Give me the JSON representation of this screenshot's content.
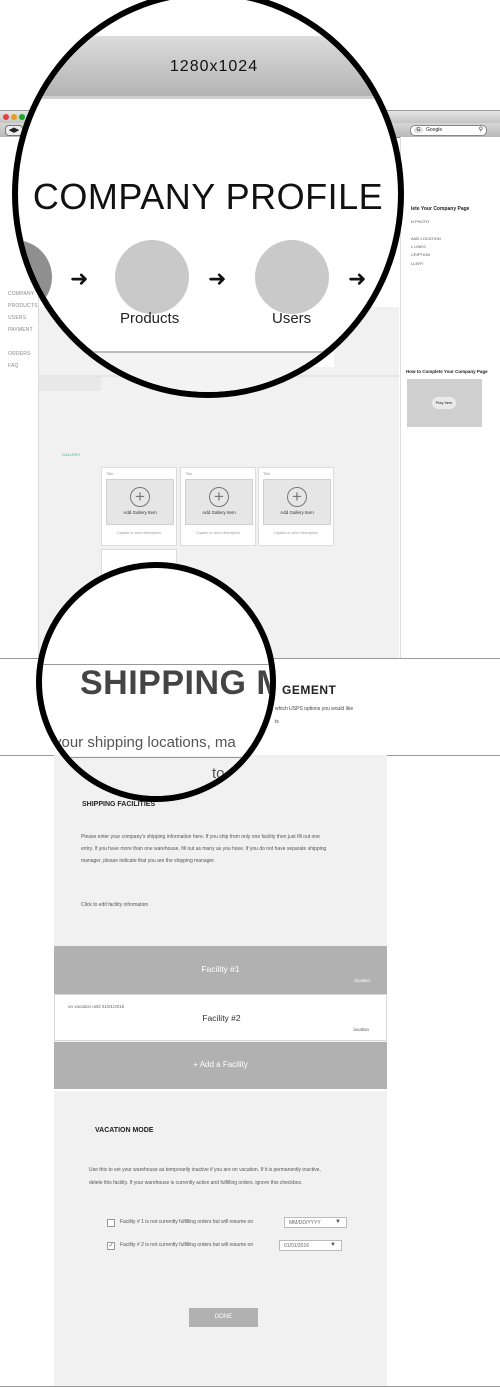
{
  "browser": {
    "search_engine": "Google",
    "left_nav": [
      "COMPANY",
      "PRODUCTS",
      "USERS",
      "PAYMENT",
      "ORDERS",
      "FAQ"
    ],
    "right_panel": {
      "title": "lete Your Company Page",
      "items": [
        "N PHOTO",
        "AND LOCATION",
        "L LINKS",
        "CRIPTION",
        "LLERY"
      ],
      "how_to_title": "How to Complete Your Company Page",
      "play_label": "Play Item"
    },
    "gallery": {
      "label": "GALLERY",
      "cards": [
        {
          "title": "Title",
          "add": "Add Gallery Item",
          "caption": "Caption or short description"
        },
        {
          "title": "Title",
          "add": "Add Gallery Item",
          "caption": "Caption or short description"
        },
        {
          "title": "Title",
          "add": "Add Gallery Item",
          "caption": "Caption or short description"
        }
      ]
    }
  },
  "magnifier_top": {
    "resolution": "1280x1024",
    "title": "COMPANY PROFILE",
    "steps": [
      "Products",
      "Users"
    ]
  },
  "banner": {
    "zoom_title": "SHIPPING M",
    "title_rest": "GEMENT",
    "zoom_sub": "your shipping locations, ma",
    "zoom_to": "to",
    "sub1": "which USPS options you would like",
    "sub2": "ts"
  },
  "shipping": {
    "title": "SHIPPING FACILITIES",
    "para1": "Please enter your company's shipping information here. If you ship from only one facility then just fill out one",
    "para2": "entry. If you have more than one warehouse, fill out as many as you have. If you do not have separate shipping",
    "para3": "manager, please indicate that you are the shipping manager.",
    "edit_hint": "Click to edit facility information",
    "facilities": [
      {
        "name": "Facility #1",
        "location": "location",
        "vacation": ""
      },
      {
        "name": "Facility #2",
        "location": "location",
        "vacation": "on vacation until  01/01/2016"
      }
    ],
    "add_label": "+ Add a Facility"
  },
  "vacation": {
    "title": "VACATION MODE",
    "para1": "Use this to set your warehouse as temporarily inactive if you are on vacation. If it is permanently inactive,",
    "para2": "delete this facility. If your warehouse is currently active and fulfilling orders, ignore this checkbox.",
    "rows": [
      {
        "checked": false,
        "text": "Facility # 1 is not currently fulfilling orders but will resume on",
        "date": "MM/DD/YYYY"
      },
      {
        "checked": true,
        "text": "Facility # 2 is not currently fulfilling orders but will resume on",
        "date": "01/01/2016"
      }
    ],
    "done_label": "DONE"
  },
  "colors": {
    "panel": "#f1f1f1",
    "button": "#b1b1b1",
    "accent_green": "#4caf8a"
  }
}
